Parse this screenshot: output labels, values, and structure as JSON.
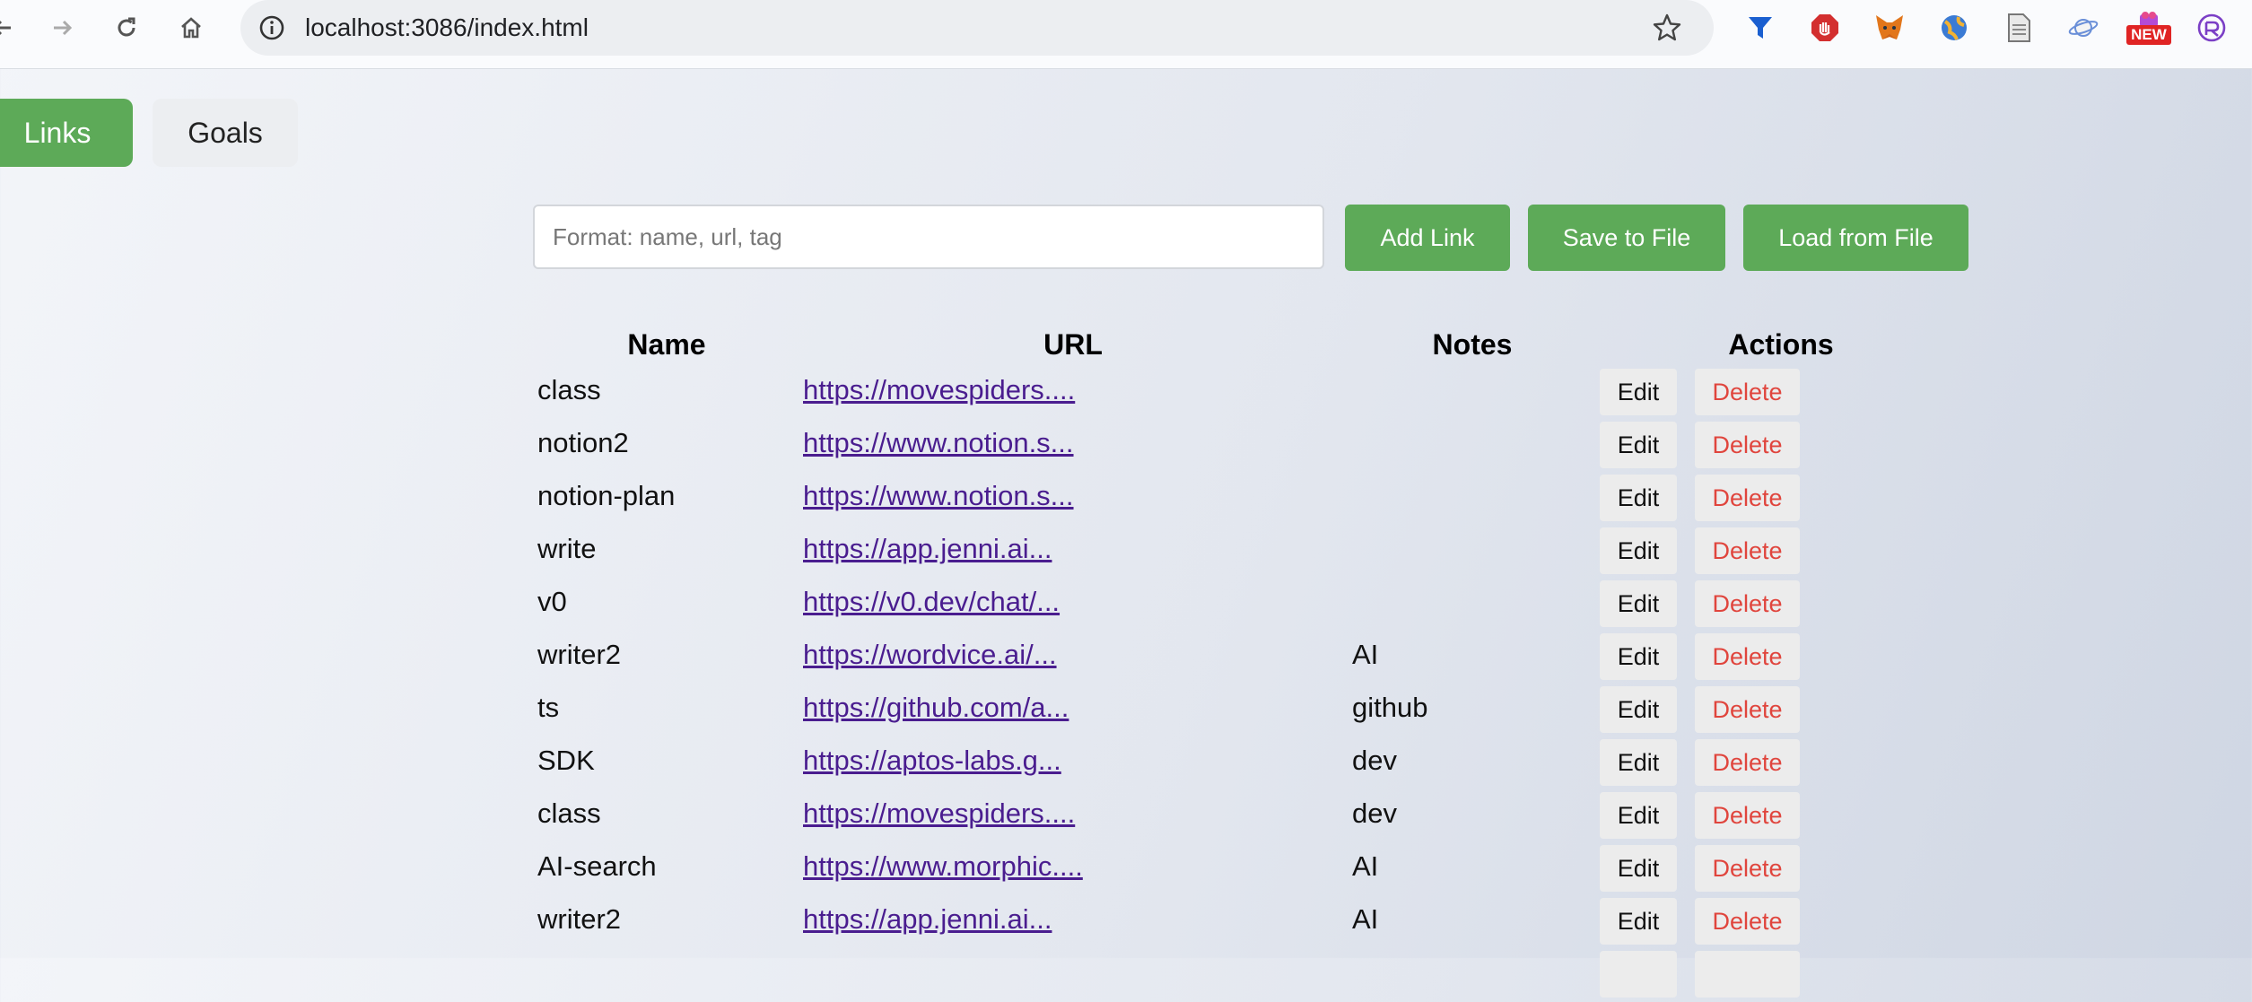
{
  "browser": {
    "url": "localhost:3086/index.html",
    "extension_badge": "NEW"
  },
  "tabs": [
    {
      "label": "Links",
      "active": true
    },
    {
      "label": "Goals",
      "active": false
    }
  ],
  "form": {
    "input_placeholder": "Format: name, url, tag",
    "input_value": "",
    "add_label": "Add Link",
    "save_label": "Save to File",
    "load_label": "Load from File"
  },
  "table": {
    "headers": {
      "name": "Name",
      "url": "URL",
      "notes": "Notes",
      "actions": "Actions"
    },
    "edit_label": "Edit",
    "delete_label": "Delete",
    "rows": [
      {
        "name": "class",
        "url": "https://movespiders....",
        "notes": ""
      },
      {
        "name": "notion2",
        "url": "https://www.notion.s...",
        "notes": ""
      },
      {
        "name": "notion-plan",
        "url": "https://www.notion.s...",
        "notes": ""
      },
      {
        "name": "write",
        "url": "https://app.jenni.ai...",
        "notes": ""
      },
      {
        "name": "v0",
        "url": "https://v0.dev/chat/...",
        "notes": ""
      },
      {
        "name": "writer2",
        "url": "https://wordvice.ai/...",
        "notes": "AI"
      },
      {
        "name": "ts",
        "url": "https://github.com/a...",
        "notes": "github"
      },
      {
        "name": "SDK",
        "url": "https://aptos-labs.g...",
        "notes": "dev"
      },
      {
        "name": "class",
        "url": "https://movespiders....",
        "notes": "dev"
      },
      {
        "name": "AI-search",
        "url": "https://www.morphic....",
        "notes": "AI"
      },
      {
        "name": "writer2",
        "url": "https://app.jenni.ai...",
        "notes": "AI"
      }
    ]
  },
  "colors": {
    "accent_green": "#5daa58",
    "delete_red": "#e0453d",
    "link_purple": "#4a1d8f"
  }
}
